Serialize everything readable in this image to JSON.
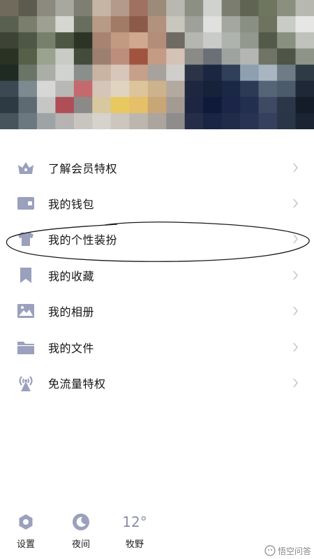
{
  "menu": {
    "items": [
      {
        "label": "了解会员特权",
        "icon": "crown-icon"
      },
      {
        "label": "我的钱包",
        "icon": "wallet-icon"
      },
      {
        "label": "我的个性装扮",
        "icon": "tshirt-icon"
      },
      {
        "label": "我的收藏",
        "icon": "bookmark-icon"
      },
      {
        "label": "我的相册",
        "icon": "photo-icon"
      },
      {
        "label": "我的文件",
        "icon": "folder-icon"
      },
      {
        "label": "免流量特权",
        "icon": "antenna-icon"
      }
    ]
  },
  "bottom": {
    "settings_label": "设置",
    "night_label": "夜间",
    "temperature": "12°",
    "city": "牧野"
  },
  "watermark": {
    "text": "悟空问答"
  },
  "colors": {
    "icon": "#9aa0bd",
    "text": "#151515",
    "chevron": "#c7c7cc",
    "annotation": "#1a1a1a"
  }
}
